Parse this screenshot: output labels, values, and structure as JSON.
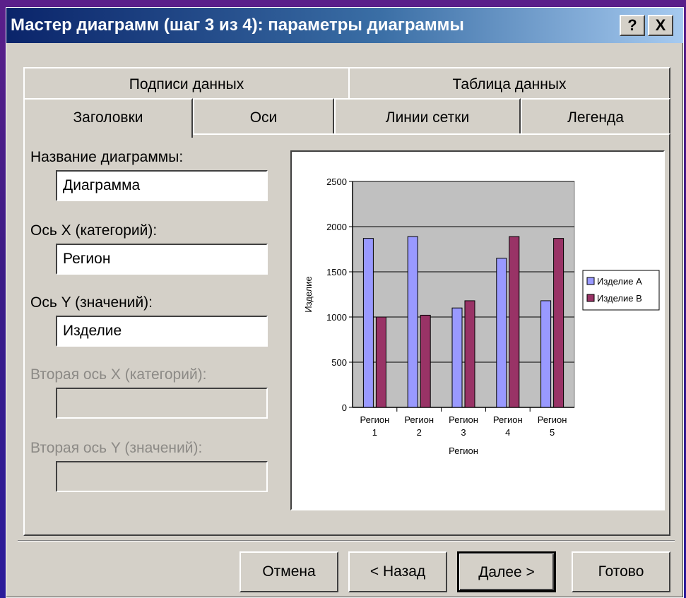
{
  "window": {
    "title": "Мастер диаграмм (шаг 3 из 4): параметры диаграммы",
    "help_label": "?",
    "close_label": "X"
  },
  "tabs_back": [
    {
      "label": "Подписи данных"
    },
    {
      "label": "Таблица данных"
    }
  ],
  "tabs_front": [
    {
      "label": "Заголовки",
      "active": true
    },
    {
      "label": "Оси"
    },
    {
      "label": "Линии сетки"
    },
    {
      "label": "Легенда"
    }
  ],
  "form": {
    "chart_title_label": "Название диаграммы:",
    "chart_title_value": "Диаграмма",
    "x_axis_label": "Ось X (категорий):",
    "x_axis_value": "Регион",
    "y_axis_label": "Ось Y (значений):",
    "y_axis_value": "Изделие",
    "x2_axis_label": "Вторая ось X (категорий):",
    "x2_axis_value": "",
    "y2_axis_label": "Вторая ось Y (значений):",
    "y2_axis_value": ""
  },
  "buttons": {
    "cancel": "Отмена",
    "back": "< Назад",
    "next": "Далее >",
    "finish": "Готово"
  },
  "chart_data": {
    "type": "bar",
    "categories": [
      "Регион 1",
      "Регион 2",
      "Регион 3",
      "Регион 4",
      "Регион 5"
    ],
    "series": [
      {
        "name": "Изделие А",
        "values": [
          1870,
          1890,
          1100,
          1650,
          1180
        ],
        "color": "#9999ff"
      },
      {
        "name": "Изделие В",
        "values": [
          1000,
          1020,
          1180,
          1890,
          1870
        ],
        "color": "#993366"
      }
    ],
    "ylim": [
      0,
      2500
    ],
    "yticks": [
      0,
      500,
      1000,
      1500,
      2000,
      2500
    ],
    "xlabel": "Регион",
    "ylabel": "Изделие",
    "legend_position": "right",
    "plot_background": "#c0c0c0",
    "grid": true
  }
}
